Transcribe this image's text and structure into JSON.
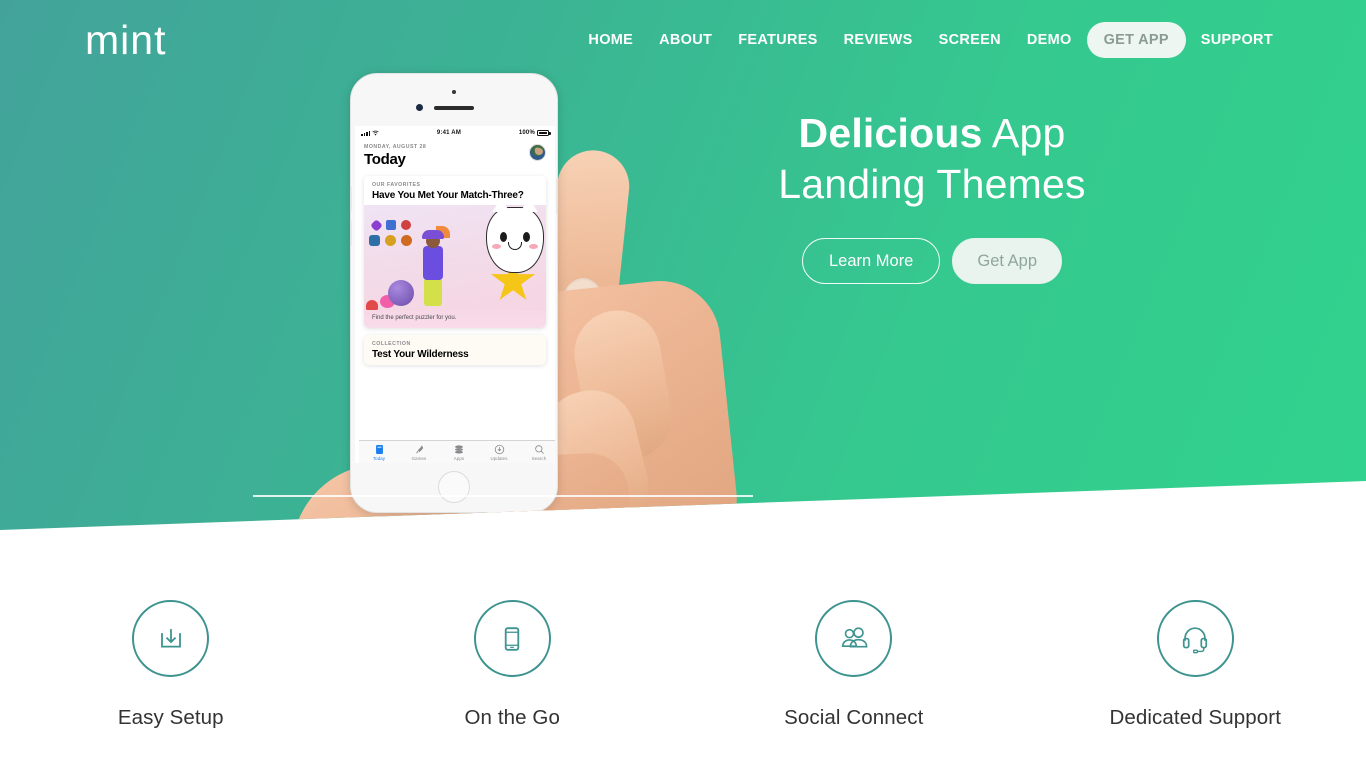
{
  "site": {
    "logo": "mint",
    "accent_green": "#31d38d",
    "accent_teal": "#43a39b",
    "icon_teal": "#3d938f",
    "text_dark": "#333333"
  },
  "nav": {
    "items": [
      {
        "label": "HOME",
        "style": "plain"
      },
      {
        "label": "ABOUT",
        "style": "plain"
      },
      {
        "label": "FEATURES",
        "style": "plain"
      },
      {
        "label": "REVIEWS",
        "style": "plain"
      },
      {
        "label": "SCREEN",
        "style": "plain"
      },
      {
        "label": "DEMO",
        "style": "plain"
      },
      {
        "label": "GET APP",
        "style": "pill"
      },
      {
        "label": "SUPPORT",
        "style": "plain"
      }
    ]
  },
  "hero": {
    "title_bold": "Delicious",
    "title_rest": " App",
    "title_line2": "Landing Themes",
    "primary_button": "Learn More",
    "secondary_button": "Get App"
  },
  "phone": {
    "status": {
      "time": "9:41 AM",
      "battery_percent": "100%"
    },
    "today": {
      "date": "MONDAY, AUGUST 28",
      "title": "Today"
    },
    "card": {
      "kicker": "OUR FAVORITES",
      "title": "Have You Met Your Match-Three?",
      "caption": "Find the perfect puzzler for you."
    },
    "card2": {
      "kicker": "COLLECTION",
      "title": "Test Your Wilderness"
    },
    "tabs": [
      {
        "label": "Today",
        "icon": "today-icon",
        "active": true
      },
      {
        "label": "Games",
        "icon": "rocket-icon",
        "active": false
      },
      {
        "label": "Apps",
        "icon": "apps-stack-icon",
        "active": false
      },
      {
        "label": "Updates",
        "icon": "download-icon",
        "active": false
      },
      {
        "label": "Search",
        "icon": "search-icon",
        "active": false
      }
    ]
  },
  "features": [
    {
      "label": "Easy Setup",
      "icon": "download-tray-icon"
    },
    {
      "label": "On the Go",
      "icon": "smartphone-icon"
    },
    {
      "label": "Social Connect",
      "icon": "users-icon"
    },
    {
      "label": "Dedicated Support",
      "icon": "headset-icon"
    }
  ]
}
